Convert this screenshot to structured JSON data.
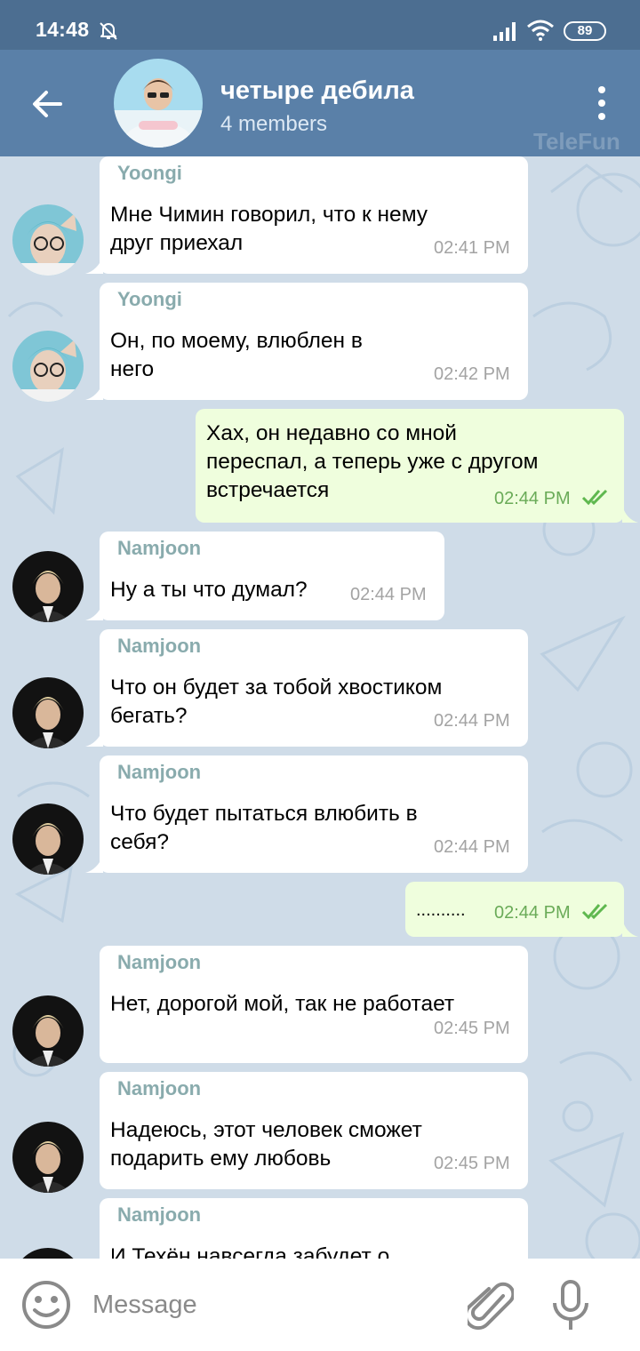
{
  "status": {
    "time": "14:48",
    "battery": "89"
  },
  "header": {
    "title": "четыре дебила",
    "subtitle": "4 members",
    "watermark": "TeleFun"
  },
  "messages": [
    {
      "sender": "Yoongi",
      "text": "Мне Чимин говорил, что к нему\nдруг приехал",
      "time": "02:41 PM"
    },
    {
      "sender": "Yoongi",
      "text": "Он, по моему, влюблен в\nнего",
      "time": "02:42 PM"
    },
    {
      "text": "Хах, он недавно со мной\nпереспал, а теперь уже с другом\nвстречается",
      "time": "02:44 PM"
    },
    {
      "sender": "Namjoon",
      "text": "Ну а ты что думал?",
      "time": "02:44 PM"
    },
    {
      "sender": "Namjoon",
      "text": "Что он будет за тобой хвостиком\nбегать?",
      "time": "02:44 PM"
    },
    {
      "sender": "Namjoon",
      "text": "Что будет пытаться влюбить в\nсебя?",
      "time": "02:44 PM"
    },
    {
      "text": "..........",
      "time": "02:44 PM"
    },
    {
      "sender": "Namjoon",
      "text": "Нет, дорогой мой, так не работает",
      "time": "02:45 PM"
    },
    {
      "sender": "Namjoon",
      "text": "Надеюсь, этот человек сможет\nподарить ему любовь",
      "time": "02:45 PM"
    },
    {
      "sender": "Namjoon",
      "text": "И Техён навсегда забудет о",
      "time": ""
    }
  ],
  "input": {
    "placeholder": "Message"
  },
  "icons": {
    "back": "arrow-left-icon",
    "menu": "more-vertical-icon",
    "bell": "bell-off-icon",
    "emoji": "emoji-icon",
    "attach": "paperclip-icon",
    "mic": "microphone-icon",
    "read": "double-check-icon"
  },
  "colors": {
    "header": "#5a80a8",
    "statusbar": "#4c6e91",
    "chat_bg": "#cfdce8",
    "bubble_in": "#ffffff",
    "bubble_out": "#effedd",
    "sender_name": "#89abad",
    "time_in": "#a3a3a3",
    "time_out": "#6aab58"
  }
}
